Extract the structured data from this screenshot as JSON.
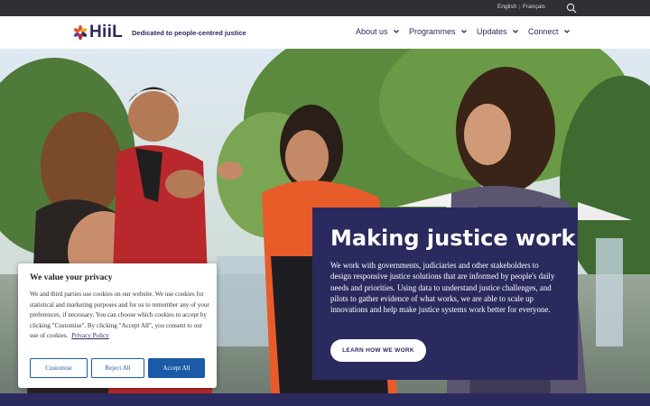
{
  "topbar": {
    "languages": [
      "English",
      "Français"
    ],
    "search_icon": "search-icon"
  },
  "header": {
    "logo_text": "HiiL",
    "tagline": "Dedicated to people-centred justice",
    "nav": [
      {
        "label": "About us",
        "icon": "chevron-down-icon"
      },
      {
        "label": "Programmes",
        "icon": "chevron-down-icon"
      },
      {
        "label": "Updates",
        "icon": "chevron-down-icon"
      },
      {
        "label": "Connect",
        "icon": "chevron-down-icon"
      }
    ]
  },
  "hero": {
    "title": "Making justice work",
    "body": "We work with governments, judiciaries and other stakeholders to design responsive justice solutions that are informed by people's daily needs and priorities. Using data to understand justice challenges, and pilots to gather evidence of what works, we are able to scale up innovations and help make justice systems work better for everyone.",
    "cta": "LEARN HOW WE WORK"
  },
  "cookie_banner": {
    "title": "We value your privacy",
    "text": "We and third parties use cookies on our website. We use cookies for statistical and marketing purposes and for us to remember any of your preferences, if necessary. You can choose which cookies to accept by clicking \"Customise\". By clicking \"Accept All\", you consent to our use of cookies.",
    "policy_link": "Privacy Policy",
    "buttons": {
      "customise": "Customise",
      "reject": "Reject All",
      "accept": "Accept All"
    }
  },
  "colors": {
    "brand_navy": "#2b2a5f",
    "topbar": "#2f3033",
    "cookie_blue": "#1a5aa6"
  }
}
